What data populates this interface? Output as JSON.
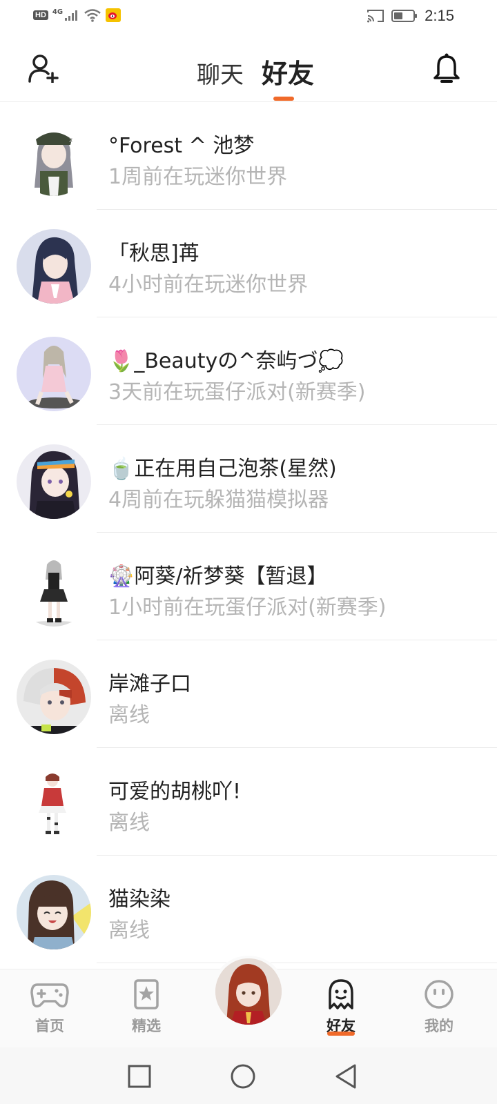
{
  "status_bar": {
    "hd_badge": "HD",
    "network": "4G",
    "time": "2:15",
    "icons": [
      "signal-icon",
      "wifi-icon",
      "weibo-icon",
      "cast-icon",
      "battery-icon"
    ]
  },
  "header": {
    "tabs": [
      {
        "label": "聊天",
        "active": false
      },
      {
        "label": "好友",
        "active": true
      }
    ],
    "accent_color": "#f06a2a",
    "left_icon": "add-friend-icon",
    "right_icon": "bell-icon"
  },
  "friends": [
    {
      "name": "°Forest ^ 池梦",
      "status": "1周前在玩迷你世界"
    },
    {
      "name": "「秋思]苒",
      "status": "4小时前在玩迷你世界"
    },
    {
      "name": "🌷_Beautyの^奈屿づ💭",
      "status": "3天前在玩蛋仔派对(新赛季)"
    },
    {
      "name": "🍵正在用自己泡茶(星然)",
      "status": "4周前在玩躲猫猫模拟器"
    },
    {
      "name": "🎡阿葵/祈梦葵【暂退】",
      "status": "1小时前在玩蛋仔派对(新赛季)"
    },
    {
      "name": "岸滩子口",
      "status": "离线"
    },
    {
      "name": "可爱的胡桃吖!",
      "status": "离线"
    },
    {
      "name": "猫染染",
      "status": "离线"
    }
  ],
  "bottom_nav": {
    "items": [
      {
        "label": "首页",
        "icon": "gamepad-icon",
        "active": false
      },
      {
        "label": "精选",
        "icon": "star-bookmark-icon",
        "active": false
      },
      {
        "label": "好友",
        "icon": "ghost-icon",
        "active": true
      },
      {
        "label": "我的",
        "icon": "smiley-icon",
        "active": false
      }
    ]
  },
  "system_nav": {
    "icons": [
      "recent-apps-icon",
      "home-icon",
      "back-icon"
    ]
  }
}
